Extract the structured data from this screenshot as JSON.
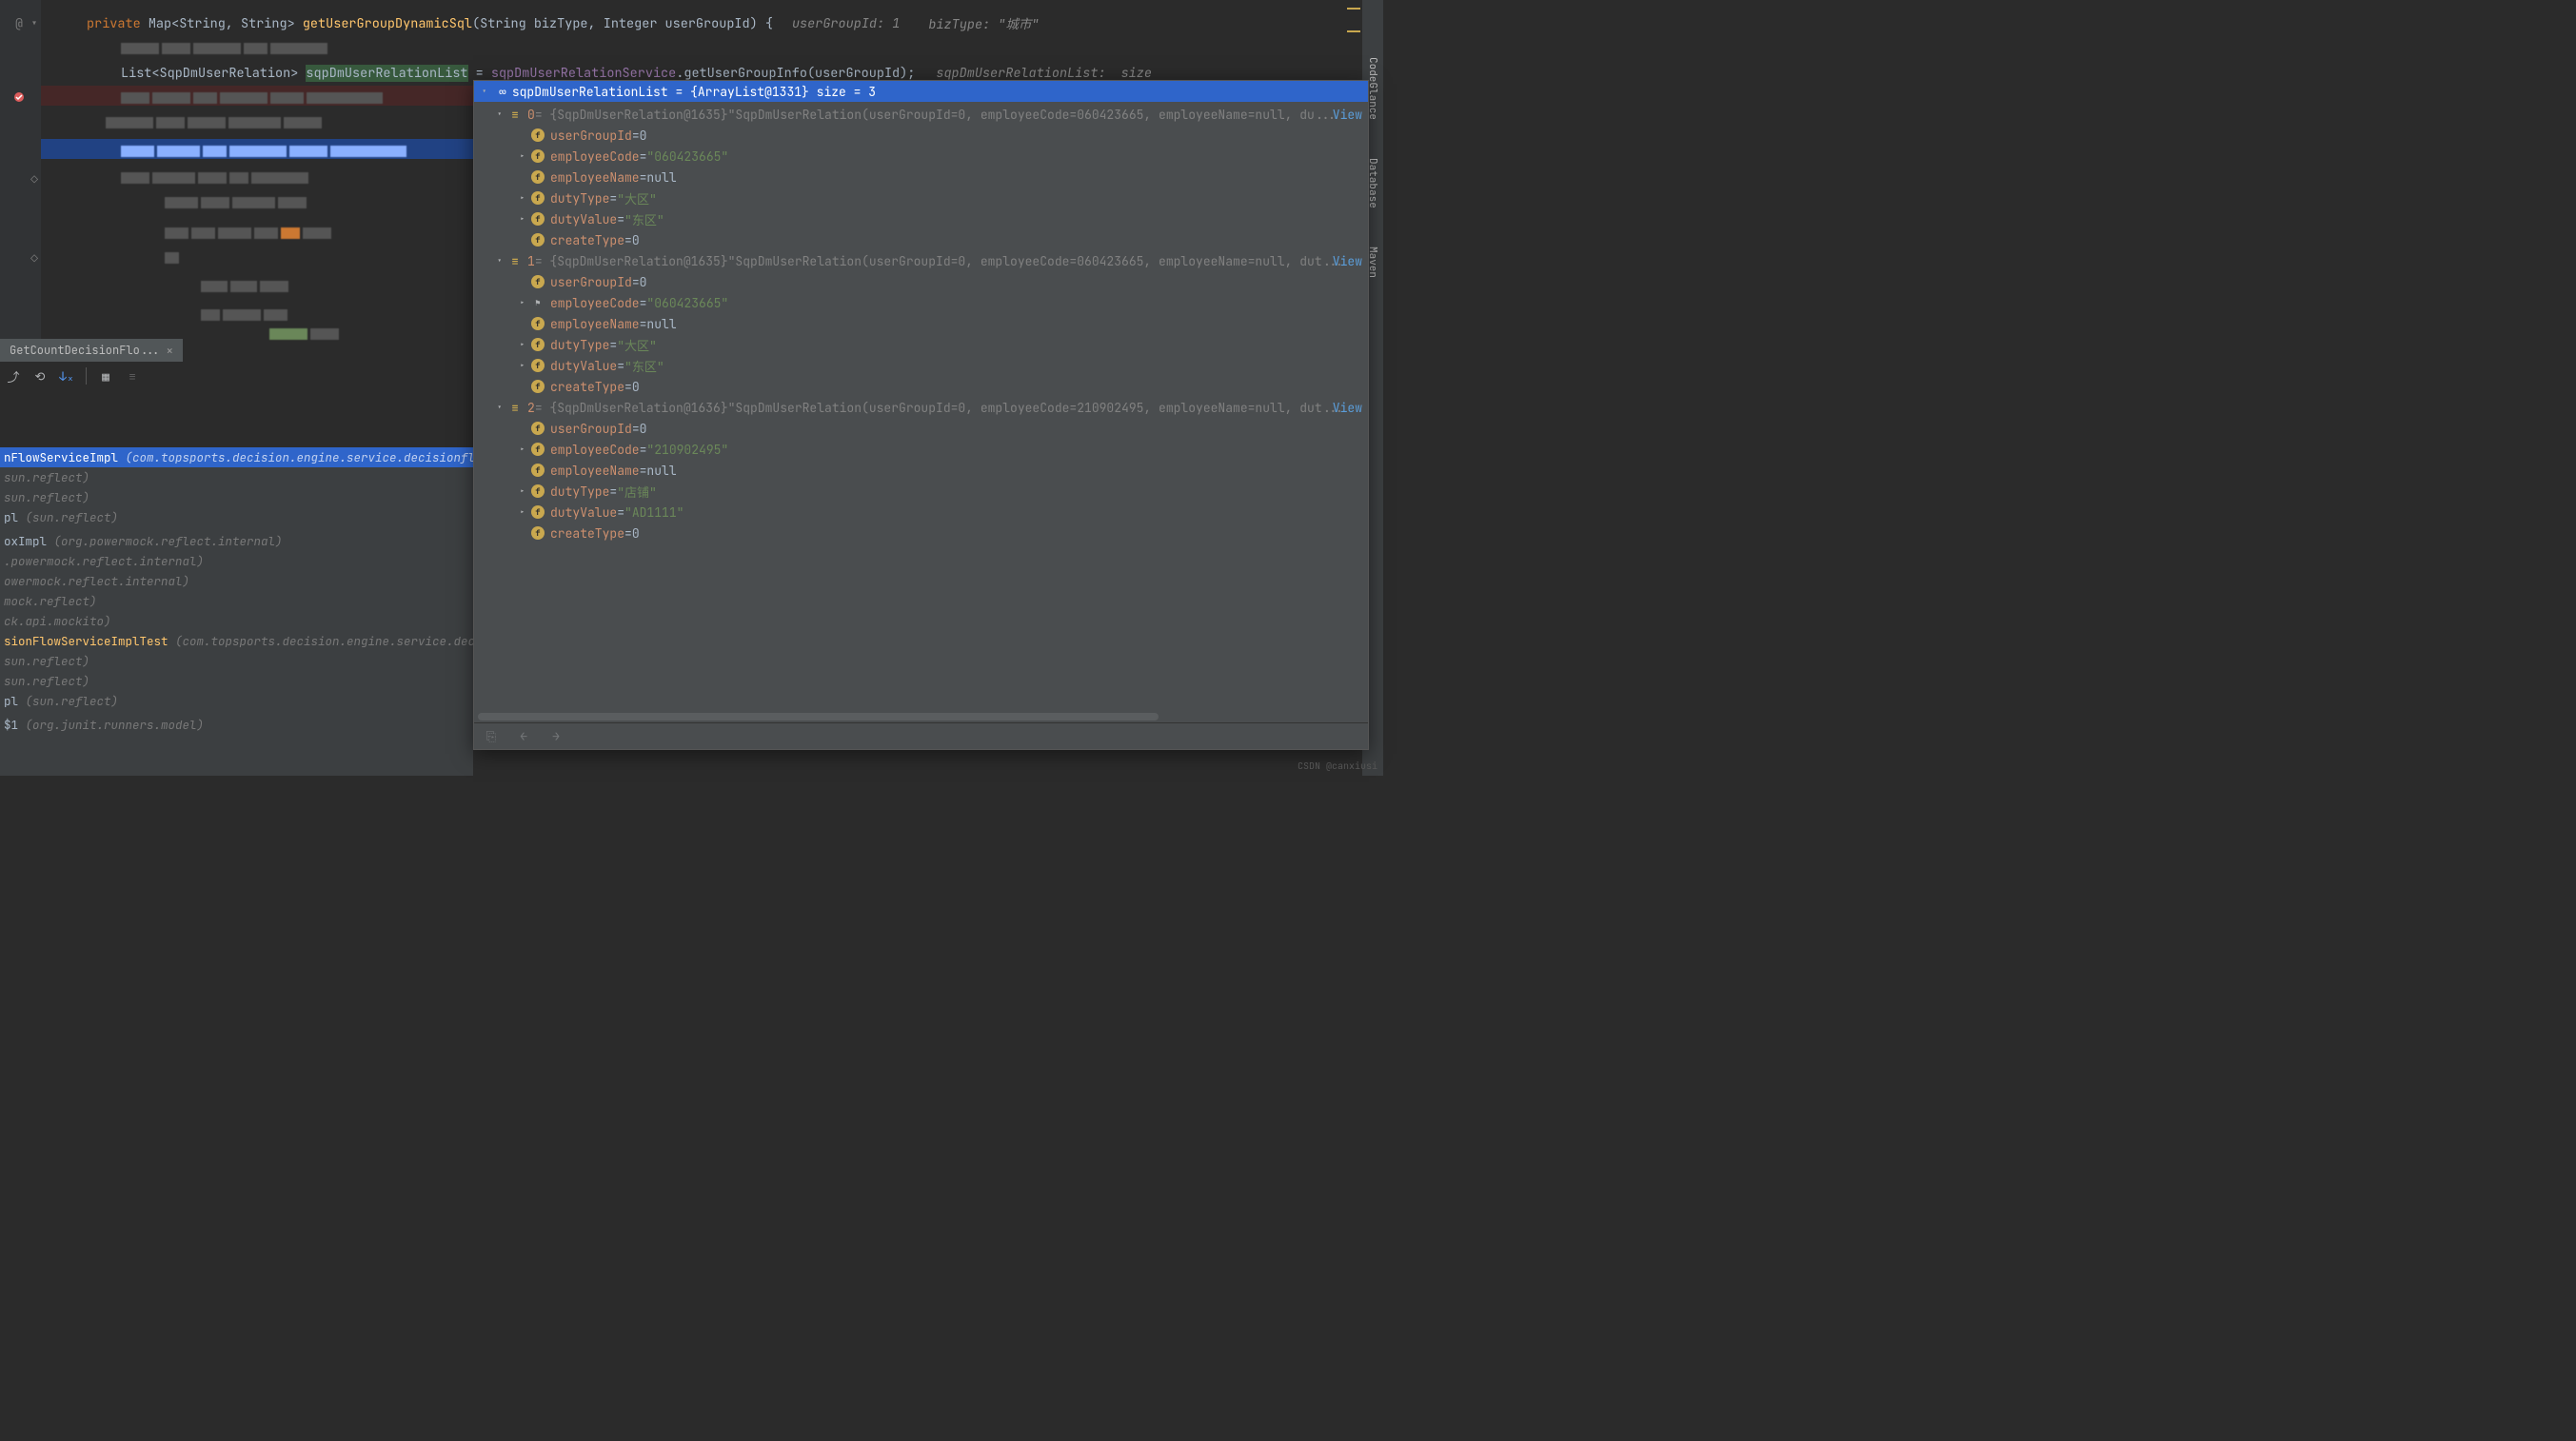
{
  "editor": {
    "line1": {
      "kw": "private",
      "type": "Map<String, String>",
      "method": "getUserGroupDynamicSql",
      "params": "(String bizType, Integer userGroupId) {",
      "hint1": "userGroupId: 1",
      "hint2": "bizType: \"城市\""
    },
    "line2": {
      "type": "List<SqpDmUserRelation>",
      "var": "sqpDmUserRelationList",
      "eq": " = ",
      "svc": "sqpDmUserRelationService",
      "call": ".getUserGroupInfo(userGroupId);",
      "hint1": "sqpDmUserRelationList:",
      "hint2": "size"
    }
  },
  "tab": {
    "name": "GetCountDecisionFlo..."
  },
  "right_tools": [
    "CodeGlance",
    "Database",
    "Maven"
  ],
  "frames": [
    {
      "cls": "nFlowServiceImpl",
      "pkg": "(com.topsports.decision.engine.service.decisionflow.imp",
      "selected": true
    },
    {
      "cls": "",
      "pkg": "sun.reflect)"
    },
    {
      "cls": "",
      "pkg": "sun.reflect)"
    },
    {
      "cls": "pl",
      "pkg": "(sun.reflect)"
    },
    {
      "cls": "",
      "pkg": ""
    },
    {
      "cls": "oxImpl",
      "pkg": "(org.powermock.reflect.internal)"
    },
    {
      "cls": "",
      "pkg": ".powermock.reflect.internal)"
    },
    {
      "cls": "",
      "pkg": "owermock.reflect.internal)"
    },
    {
      "cls": "",
      "pkg": "mock.reflect)"
    },
    {
      "cls": "",
      "pkg": "ck.api.mockito)"
    },
    {
      "cls": "sionFlowServiceImplTest",
      "pkg": "(com.topsports.decision.engine.service.decisionf"
    },
    {
      "cls": "",
      "pkg": "sun.reflect)"
    },
    {
      "cls": "",
      "pkg": "sun.reflect)"
    },
    {
      "cls": "pl",
      "pkg": "(sun.reflect)"
    },
    {
      "cls": "",
      "pkg": ""
    },
    {
      "cls": "$1",
      "pkg": "(org.junit.runners.model)"
    }
  ],
  "vars": {
    "root": {
      "name": "sqpDmUserRelationList",
      "value": "= {ArrayList@1331}  size = 3"
    },
    "items": [
      {
        "index": "0",
        "obj": "= {SqpDmUserRelation@1635}",
        "preview": "\"SqpDmUserRelation(userGroupId=0, employeeCode=060423665, employeeName=null, du",
        "view": "View",
        "fields": [
          {
            "name": "userGroupId",
            "val": "0",
            "type": "num"
          },
          {
            "name": "employeeCode",
            "val": "\"060423665\"",
            "type": "str",
            "expandable": true
          },
          {
            "name": "employeeName",
            "val": "null",
            "type": "num"
          },
          {
            "name": "dutyType",
            "val": "\"大区\"",
            "type": "str",
            "expandable": true
          },
          {
            "name": "dutyValue",
            "val": "\"东区\"",
            "type": "str",
            "expandable": true
          },
          {
            "name": "createType",
            "val": "0",
            "type": "num"
          }
        ]
      },
      {
        "index": "1",
        "obj": "= {SqpDmUserRelation@1635}",
        "preview": "\"SqpDmUserRelation(userGroupId=0, employeeCode=060423665, employeeName=null, dut",
        "view": "View",
        "fields": [
          {
            "name": "userGroupId",
            "val": "0",
            "type": "num"
          },
          {
            "name": "employeeCode",
            "val": "\"060423665\"",
            "type": "str",
            "expandable": true,
            "flag": true
          },
          {
            "name": "employeeName",
            "val": "null",
            "type": "num"
          },
          {
            "name": "dutyType",
            "val": "\"大区\"",
            "type": "str",
            "expandable": true
          },
          {
            "name": "dutyValue",
            "val": "\"东区\"",
            "type": "str",
            "expandable": true
          },
          {
            "name": "createType",
            "val": "0",
            "type": "num"
          }
        ]
      },
      {
        "index": "2",
        "obj": "= {SqpDmUserRelation@1636}",
        "preview": "\"SqpDmUserRelation(userGroupId=0, employeeCode=210902495, employeeName=null, dut",
        "view": "View",
        "fields": [
          {
            "name": "userGroupId",
            "val": "0",
            "type": "num"
          },
          {
            "name": "employeeCode",
            "val": "\"210902495\"",
            "type": "str",
            "expandable": true
          },
          {
            "name": "employeeName",
            "val": "null",
            "type": "num"
          },
          {
            "name": "dutyType",
            "val": "\"店铺\"",
            "type": "str",
            "expandable": true
          },
          {
            "name": "dutyValue",
            "val": "\"AD1111\"",
            "type": "str",
            "expandable": true
          },
          {
            "name": "createType",
            "val": "0",
            "type": "num"
          }
        ]
      }
    ]
  },
  "watermark": "CSDN @canxiusi"
}
